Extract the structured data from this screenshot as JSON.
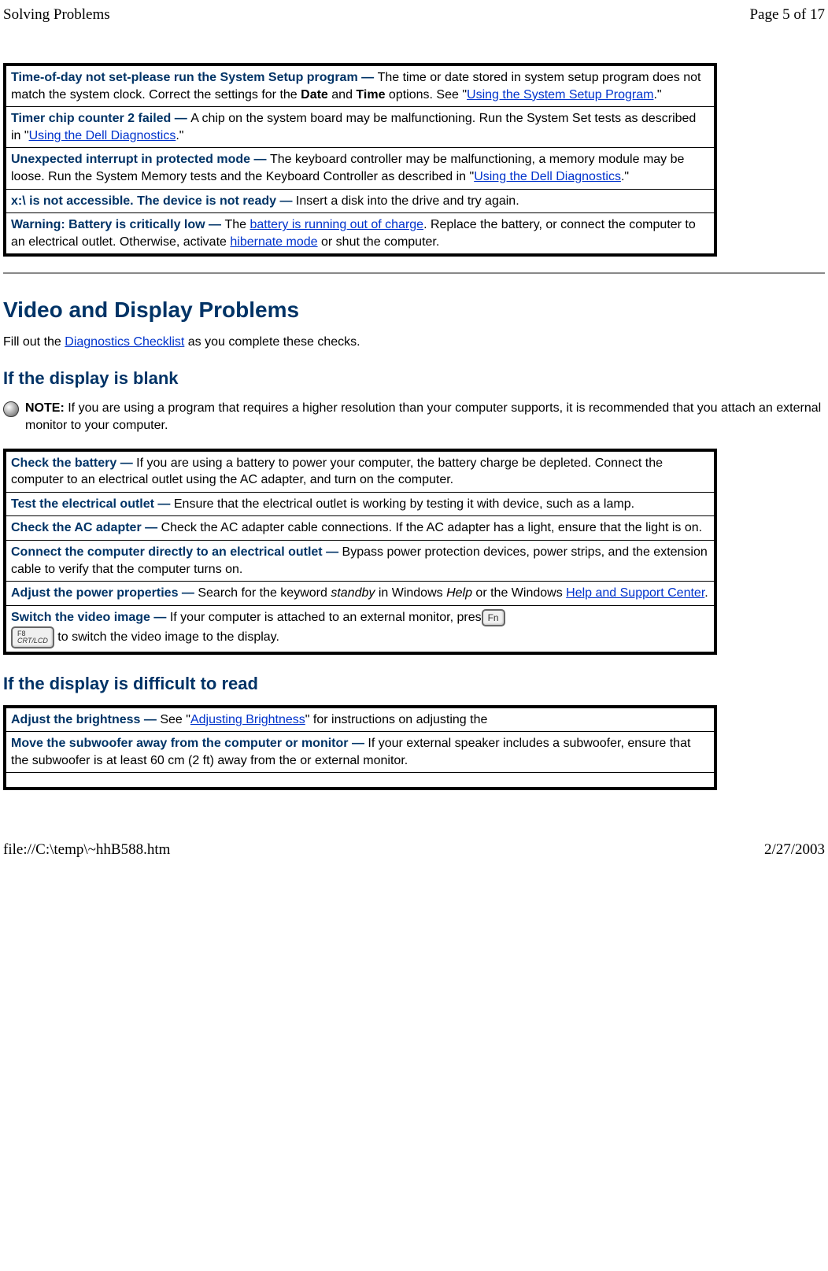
{
  "header": {
    "left": "Solving Problems",
    "right": "Page 5 of 17"
  },
  "footer": {
    "left": "file://C:\\temp\\~hhB588.htm",
    "right": "2/27/2003"
  },
  "table1": {
    "rows": [
      {
        "title": "Time-of-day not set-please run the System Setup program — ",
        "body_pre": "The time or date stored in system setup program does not match the system clock. Correct the settings for the ",
        "bold1": "Date",
        "mid": " and ",
        "bold2": "Time",
        "post": " options. See \"",
        "link": "Using the System Setup Program",
        "tail": ".\""
      },
      {
        "title": "Timer chip counter 2 failed — ",
        "body_pre": "A chip on the system board may be malfunctioning. Run the System Set tests as described in \"",
        "link": "Using the Dell Diagnostics",
        "tail": ".\""
      },
      {
        "title": "Unexpected interrupt in protected mode — ",
        "body_pre": "The keyboard controller may be malfunctioning, a memory module may be loose. Run the System Memory tests and the Keyboard Controller as described in \"",
        "link": "Using the Dell Diagnostics",
        "tail": ".\""
      },
      {
        "title": "x:\\ is not accessible. The device is not ready — ",
        "body_pre": "Insert a disk into the drive and try again."
      },
      {
        "title": "Warning: Battery is critically low — ",
        "body_pre": "The ",
        "link": "battery is running out of charge",
        "mid2": ". Replace the battery, or connect the computer to an electrical outlet. Otherwise, activate ",
        "link2": "hibernate mode",
        "tail": " or shut the computer."
      }
    ]
  },
  "section_heading": "Video and Display Problems",
  "intro_pre": "Fill out the ",
  "intro_link": "Diagnostics Checklist",
  "intro_post": " as you complete these checks.",
  "subheading1": "If the display is blank",
  "note_label": "NOTE:",
  "note_text": " If you are using a program that requires a higher resolution than your computer supports, it is recommended that you attach an external monitor to your computer.",
  "table2": {
    "rows": [
      {
        "title": "Check the battery — ",
        "body": "If you are using a battery to power your computer, the battery charge be depleted. Connect the computer to an electrical outlet using the AC adapter, and turn on the computer."
      },
      {
        "title": "Test the electrical outlet — ",
        "body": "Ensure that the electrical outlet is working by testing it with device, such as a lamp."
      },
      {
        "title": "Check the AC adapter — ",
        "body": "Check the AC adapter cable connections. If the AC adapter has a light, ensure that the light is on."
      },
      {
        "title": "Connect the computer directly to an electrical outlet — ",
        "body": "Bypass power protection devices, power strips, and the extension cable to verify that the computer turns on."
      },
      {
        "title": "Adjust the power properties — ",
        "body_pre": "Search for the keyword ",
        "italic1": "standby",
        "mid": " in Windows ",
        "italic2": "Help",
        "post": " or the Windows ",
        "link": "Help and Support Center",
        "tail": "."
      },
      {
        "title": "Switch the video image — ",
        "body_pre": "If your computer is attached to an external monitor, pres",
        "key1": "Fn",
        "key2_top": "F8",
        "key2_bot": "CRT/LCD",
        "tail": " to switch the video image to the display."
      }
    ]
  },
  "subheading2": "If the display is difficult to read",
  "table3": {
    "rows": [
      {
        "title": "Adjust the brightness — ",
        "body_pre": "See \"",
        "link": "Adjusting Brightness",
        "tail": "\" for instructions on adjusting the"
      },
      {
        "title": "Move the subwoofer away from the computer or monitor — ",
        "body": "If your external speaker includes a subwoofer, ensure that the subwoofer is at least 60 cm (2 ft) away from the or external monitor."
      }
    ]
  }
}
